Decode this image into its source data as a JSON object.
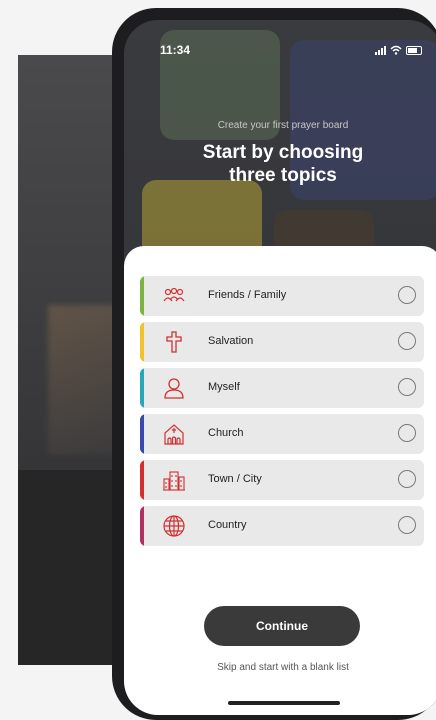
{
  "status_bar": {
    "time": "11:34"
  },
  "header": {
    "subtitle": "Create your first prayer board",
    "title_line1": "Start by choosing",
    "title_line2": "three topics"
  },
  "topics": [
    {
      "label": "Friends / Family",
      "icon": "people-icon",
      "color": "#7cb342"
    },
    {
      "label": "Salvation",
      "icon": "cross-icon",
      "color": "#f2c12e"
    },
    {
      "label": "Myself",
      "icon": "person-icon",
      "color": "#2aa6b9"
    },
    {
      "label": "Church",
      "icon": "church-icon",
      "color": "#3949ab"
    },
    {
      "label": "Town / City",
      "icon": "building-icon",
      "color": "#d32f2f"
    },
    {
      "label": "Country",
      "icon": "globe-icon",
      "color": "#b03060"
    }
  ],
  "actions": {
    "continue_label": "Continue",
    "skip_label": "Skip and start with a blank list"
  },
  "colors": {
    "icon_red": "#d32f2f",
    "button_dark": "#3a3a3a"
  }
}
